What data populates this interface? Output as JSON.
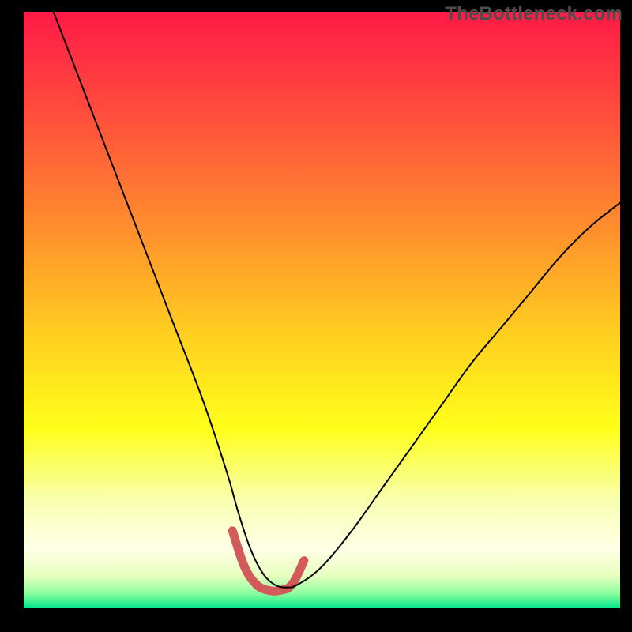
{
  "watermark": "TheBottleneck.com",
  "chart_data": {
    "type": "line",
    "title": "",
    "xlabel": "",
    "ylabel": "",
    "xlim": [
      0,
      100
    ],
    "ylim": [
      0,
      100
    ],
    "grid": false,
    "legend": false,
    "background_gradient": {
      "stops": [
        {
          "offset": 0.0,
          "color": "#ff1a47"
        },
        {
          "offset": 0.17,
          "color": "#ff4d3c"
        },
        {
          "offset": 0.35,
          "color": "#ff8a2e"
        },
        {
          "offset": 0.55,
          "color": "#ffd21f"
        },
        {
          "offset": 0.7,
          "color": "#ffff1a"
        },
        {
          "offset": 0.82,
          "color": "#f8ffb0"
        },
        {
          "offset": 0.9,
          "color": "#ffffe6"
        },
        {
          "offset": 0.945,
          "color": "#e8ffc0"
        },
        {
          "offset": 0.975,
          "color": "#8cff9e"
        },
        {
          "offset": 1.0,
          "color": "#00e58a"
        }
      ]
    },
    "series": [
      {
        "name": "primary-curve",
        "color": "#000000",
        "width": 2.0,
        "x": [
          5,
          10,
          15,
          20,
          25,
          30,
          34,
          36,
          38,
          40,
          42,
          44,
          46,
          50,
          55,
          60,
          65,
          70,
          75,
          80,
          85,
          90,
          95,
          100
        ],
        "y": [
          100,
          87,
          74,
          61,
          48,
          35,
          23,
          16,
          10,
          6,
          4,
          3.5,
          4,
          7,
          13,
          20,
          27,
          34,
          41,
          47,
          53,
          59,
          64,
          68
        ]
      },
      {
        "name": "highlight-segment",
        "color": "#d25a5a",
        "width": 11,
        "linecap": "round",
        "x": [
          35,
          37,
          39,
          41,
          43,
          45,
          47
        ],
        "y": [
          13,
          7,
          4,
          3,
          3,
          4,
          8
        ]
      }
    ]
  }
}
